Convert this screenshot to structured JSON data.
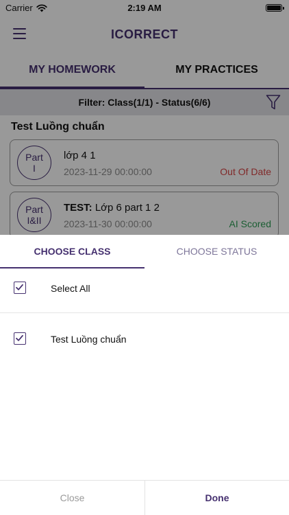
{
  "status_bar": {
    "carrier": "Carrier",
    "time": "2:19 AM"
  },
  "header": {
    "title": "ICORRECT"
  },
  "tabs": [
    {
      "label": "MY HOMEWORK"
    },
    {
      "label": "MY PRACTICES"
    }
  ],
  "filter": {
    "text": "Filter: Class(1/1) - Status(6/6)"
  },
  "class_heading": "Test Luồng chuẩn",
  "homework": [
    {
      "part_line1": "Part",
      "part_line2": "I",
      "title": "lớp 4 1",
      "date": "2023-11-29 00:00:00",
      "status": "Out Of Date",
      "status_color": "#d64545"
    },
    {
      "part_line1": "Part",
      "part_line2": "I&II",
      "title_prefix": "TEST:",
      "title": "Lớp 6 part 1 2",
      "date": "2023-11-30 00:00:00",
      "status": "AI Scored",
      "status_color": "#2e9d55"
    }
  ],
  "sheet": {
    "tabs": [
      {
        "label": "CHOOSE CLASS"
      },
      {
        "label": "CHOOSE STATUS"
      }
    ],
    "options": [
      {
        "label": "Select All",
        "checked": true
      },
      {
        "label": "Test Luồng chuẩn",
        "checked": true
      }
    ],
    "close_label": "Close",
    "done_label": "Done"
  },
  "colors": {
    "accent": "#45306f",
    "overdue": "#d64545",
    "scored": "#2e9d55"
  }
}
